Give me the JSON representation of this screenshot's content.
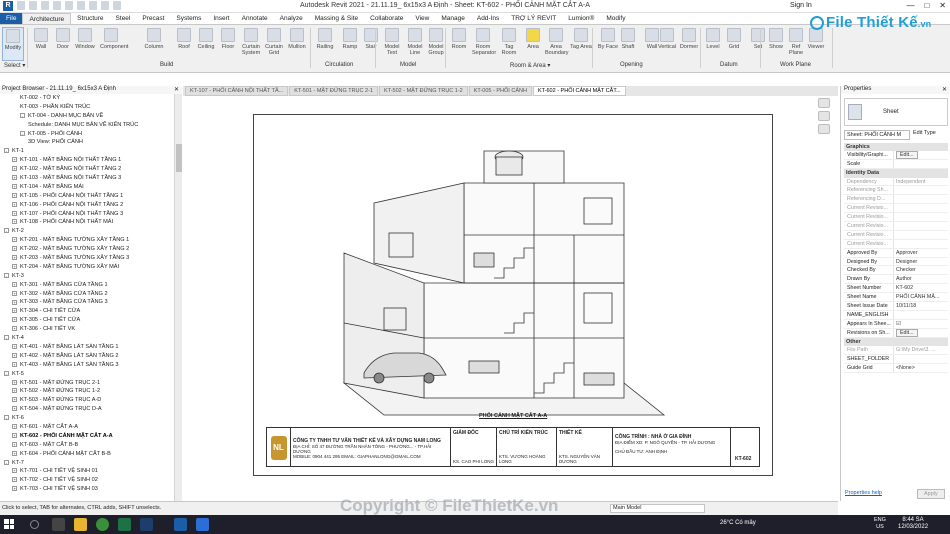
{
  "window": {
    "title": "Autodesk Revit 2021 - 21.11.19_ 6x15x3 A Định - Sheet: KT-602 - PHỐI CẢNH MẶT CẮT A-A",
    "app_icon": "R",
    "sign_in": "Sign In",
    "controls": [
      "—",
      "□",
      "✕"
    ]
  },
  "ribbon_tabs": [
    "File",
    "Architecture",
    "Structure",
    "Steel",
    "Precast",
    "Systems",
    "Insert",
    "Annotate",
    "Analyze",
    "Massing & Site",
    "Collaborate",
    "View",
    "Manage",
    "Add-Ins",
    "TRỢ LÝ REVIT",
    "Lumion®",
    "Modify"
  ],
  "ribbon_buttons": [
    "Modify",
    "Wall",
    "Door",
    "Window",
    "Component",
    "Column",
    "Roof",
    "Ceiling",
    "Floor",
    "Curtain System",
    "Curtain Grid",
    "Mullion",
    "Railing",
    "Ramp",
    "Stair",
    "Model Text",
    "Model Line",
    "Model Group",
    "Room",
    "Room Separator",
    "Tag Room",
    "Area",
    "Area Boundary",
    "Tag Area",
    "By Face",
    "Shaft",
    "Wall",
    "Vertical",
    "Dormer",
    "Level",
    "Grid",
    "Set",
    "Show",
    "Ref Plane",
    "Viewer"
  ],
  "ribbon_panels": [
    "Select ▾",
    "Build",
    "Circulation",
    "Model",
    "Room & Area ▾",
    "Opening",
    "Datum",
    "Work Plane"
  ],
  "logo": {
    "text": "File Thiết Kế",
    "suffix": ".vn"
  },
  "project_browser": {
    "title": "Project Browser - 21.11.19_ 6x15x3 A Định",
    "close": "✕",
    "items": [
      {
        "label": "KT-002 - TỜ KÝ",
        "level": 3
      },
      {
        "label": "KT-003 - PHẦN KIẾN TRÚC",
        "level": 3
      },
      {
        "label": "KT-004 - DANH MỤC BẢN VẼ",
        "level": 3,
        "exp": "-"
      },
      {
        "label": "Schedule: DANH MỤC BẢN VẼ KIẾN TRÚC",
        "level": 4
      },
      {
        "label": "KT-005 - PHỐI CẢNH",
        "level": 3,
        "exp": "-"
      },
      {
        "label": "3D View: PHỐI CẢNH",
        "level": 4
      },
      {
        "label": "KT-1",
        "level": 1,
        "exp": "-"
      },
      {
        "label": "KT-101 - MẶT BẰNG NỘI THẤT TẦNG 1",
        "level": 2,
        "exp": "+"
      },
      {
        "label": "KT-102 - MẶT BẰNG NỘI THẤT TẦNG 2",
        "level": 2,
        "exp": "+"
      },
      {
        "label": "KT-103 - MẶT BẰNG NỘI THẤT TẦNG 3",
        "level": 2,
        "exp": "+"
      },
      {
        "label": "KT-104 - MẶT BẰNG MÁI",
        "level": 2,
        "exp": "+"
      },
      {
        "label": "KT-105 - PHỐI CẢNH NỘI THẤT TẦNG 1",
        "level": 2,
        "exp": "+"
      },
      {
        "label": "KT-106 - PHỐI CẢNH NỘI THẤT TẦNG 2",
        "level": 2,
        "exp": "+"
      },
      {
        "label": "KT-107 - PHỐI CẢNH NỘI THẤT TẦNG 3",
        "level": 2,
        "exp": "+"
      },
      {
        "label": "KT-108 - PHỐI CẢNH NỘI THẤT MÁI",
        "level": 2,
        "exp": "+"
      },
      {
        "label": "KT-2",
        "level": 1,
        "exp": "-"
      },
      {
        "label": "KT-201 - MẶT BẰNG TƯỜNG XÂY TẦNG 1",
        "level": 2,
        "exp": "+"
      },
      {
        "label": "KT-202 - MẶT BẰNG TƯỜNG XÂY TẦNG 2",
        "level": 2,
        "exp": "+"
      },
      {
        "label": "KT-203 - MẶT BẰNG TƯỜNG XÂY TẦNG 3",
        "level": 2,
        "exp": "+"
      },
      {
        "label": "KT-204 - MẶT BẰNG TƯỜNG XÂY MÁI",
        "level": 2,
        "exp": "+"
      },
      {
        "label": "KT-3",
        "level": 1,
        "exp": "-"
      },
      {
        "label": "KT-301 - MẶT BẰNG CỬA TẦNG 1",
        "level": 2,
        "exp": "+"
      },
      {
        "label": "KT-302 - MẶT BẰNG CỬA TẦNG 2",
        "level": 2,
        "exp": "+"
      },
      {
        "label": "KT-303 - MẶT BẰNG CỬA TẦNG 3",
        "level": 2,
        "exp": "+"
      },
      {
        "label": "KT-304 - CHI TIẾT CỬA",
        "level": 2,
        "exp": "+"
      },
      {
        "label": "KT-305 - CHI TIẾT CỬA",
        "level": 2,
        "exp": "+"
      },
      {
        "label": "KT-306 - CHI TIẾT VK",
        "level": 2,
        "exp": "+"
      },
      {
        "label": "KT-4",
        "level": 1,
        "exp": "-"
      },
      {
        "label": "KT-401 - MẶT BẰNG LÁT SÀN TẦNG 1",
        "level": 2,
        "exp": "+"
      },
      {
        "label": "KT-402 - MẶT BẰNG LÁT SÀN TẦNG 2",
        "level": 2,
        "exp": "+"
      },
      {
        "label": "KT-403 - MẶT BẰNG LÁT SÀN TẦNG 3",
        "level": 2,
        "exp": "+"
      },
      {
        "label": "KT-5",
        "level": 1,
        "exp": "-"
      },
      {
        "label": "KT-501 - MẶT ĐỨNG TRỤC 2-1",
        "level": 2,
        "exp": "+"
      },
      {
        "label": "KT-502 - MẶT ĐỨNG TRỤC 1-2",
        "level": 2,
        "exp": "+"
      },
      {
        "label": "KT-503 - MẶT ĐỨNG TRỤC A-D",
        "level": 2,
        "exp": "+"
      },
      {
        "label": "KT-504 - MẶT ĐỨNG  TRỤC D-A",
        "level": 2,
        "exp": "+"
      },
      {
        "label": "KT-6",
        "level": 1,
        "exp": "-"
      },
      {
        "label": "KT-601 - MẶT CẮT A-A",
        "level": 2,
        "exp": "+"
      },
      {
        "label": "KT-602 - PHỐI CẢNH MẶT CẮT A-A",
        "level": 2,
        "exp": "+",
        "selected": true
      },
      {
        "label": "KT-603 - MẶT CẮT B-B",
        "level": 2,
        "exp": "+"
      },
      {
        "label": "KT-604 - PHỐI CẢNH MẶT CẮT B-B",
        "level": 2,
        "exp": "+"
      },
      {
        "label": "KT-7",
        "level": 1,
        "exp": "-"
      },
      {
        "label": "KT-701 - CHI TIẾT VỆ SINH 01",
        "level": 2,
        "exp": "+"
      },
      {
        "label": "KT-702 - CHI TIẾT VỆ SINH 02",
        "level": 2,
        "exp": "+"
      },
      {
        "label": "KT-703 - CHI TIẾT VỆ SINH 03",
        "level": 2,
        "exp": "+"
      }
    ]
  },
  "doc_tabs": [
    {
      "label": "KT-107 - PHỐI CẢNH NỘI THẤT TẦ...",
      "active": false
    },
    {
      "label": "KT-501 - MẶT ĐỨNG TRỤC 2-1",
      "active": false
    },
    {
      "label": "KT-502 - MẶT ĐỨNG TRỤC 1-2",
      "active": false
    },
    {
      "label": "KT-005 - PHỐI CẢNH",
      "active": false
    },
    {
      "label": "KT-602 - PHỐI CẢNH MẶT CẮT...",
      "active": true
    }
  ],
  "sheet": {
    "caption": "PHỐI CẢNH MẶT CẮT A-A",
    "company": "CÔNG TY TNHH TƯ VẤN THIẾT KẾ VÀ XÂY DỰNG NAM LONG",
    "company_addr": "ĐỊA CHỈ: SỐ 47 ĐƯỜNG TRẦN NHÂN TÔNG - PHƯỜNG... - TP.HẢI DƯƠNG",
    "company_contact": "MOBILE: 0904 441 295  EMAIL: GIAPHANLONG@GMAIL.COM",
    "roles": [
      "GIÁM ĐỐC",
      "CHỦ TRÌ KIẾN TRÚC",
      "THIẾT KẾ"
    ],
    "names": [
      "KS. CAO PHI LONG",
      "KTS. VƯƠNG HOÀNG LONG",
      "KTS. NGUYỄN VĂN DƯƠNG"
    ],
    "project_title": "CÔNG TRÌNH : NHÀ Ở GIA ĐÌNH",
    "project_addr": "ĐỊA ĐIỂM XD: P. NGÔ QUYỀN - TP. HẢI DƯƠNG",
    "owner": "CHỦ ĐẦU TƯ: ANH ĐỊNH",
    "sheet_no": "KT-602"
  },
  "properties": {
    "title": "Properties",
    "close": "✕",
    "type_name": "Sheet",
    "selector": "Sheet: PHỐI CẢNH M",
    "edit_type": "Edit Type",
    "groups": [
      {
        "name": "Graphics",
        "rows": [
          {
            "k": "Visibility/Graphi...",
            "v": "Edit...",
            "btn": true
          },
          {
            "k": "Scale",
            "v": ""
          }
        ]
      },
      {
        "name": "Identity Data",
        "rows": [
          {
            "k": "Dependency",
            "v": "Independent",
            "dim": true
          },
          {
            "k": "Referencing Sh...",
            "v": "",
            "dim": true
          },
          {
            "k": "Referencing D...",
            "v": "",
            "dim": true
          },
          {
            "k": "Current Revisio...",
            "v": "",
            "dim": true
          },
          {
            "k": "Current Revisio...",
            "v": "",
            "dim": true
          },
          {
            "k": "Current Revisio...",
            "v": "",
            "dim": true
          },
          {
            "k": "Current Revisio...",
            "v": "",
            "dim": true
          },
          {
            "k": "Current Revisio...",
            "v": "",
            "dim": true
          },
          {
            "k": "Approved By",
            "v": "Approver"
          },
          {
            "k": "Designed By",
            "v": "Designer"
          },
          {
            "k": "Checked By",
            "v": "Checker"
          },
          {
            "k": "Drawn By",
            "v": "Author"
          },
          {
            "k": "Sheet Number",
            "v": "KT-602"
          },
          {
            "k": "Sheet Name",
            "v": "PHỐI CẢNH MẶ..."
          },
          {
            "k": "Sheet Issue Date",
            "v": "10/11/18"
          },
          {
            "k": "NAME_ENGLISH",
            "v": ""
          },
          {
            "k": "Appears In Shee...",
            "v": "☑"
          },
          {
            "k": "Revisions on Sh...",
            "v": "Edit...",
            "btn": true
          }
        ]
      },
      {
        "name": "Other",
        "rows": [
          {
            "k": "File Path",
            "v": "G:\\My Drive\\3. ...",
            "dim": true
          },
          {
            "k": "SHEET_FOLDER",
            "v": ""
          },
          {
            "k": "Guide Grid",
            "v": "<None>"
          }
        ]
      }
    ],
    "help": "Properties help",
    "apply": "Apply"
  },
  "status": {
    "text": "Click to select, TAB for alternates, CTRL adds, SHIFT unselects.",
    "model": "Main Model"
  },
  "watermark": "Copyright © FileThietKe.vn",
  "taskbar": {
    "weather": "26°C  Có mây",
    "lang": "ENG",
    "lang2": "US",
    "time": "8:44 SA",
    "date": "12/03/2022"
  }
}
